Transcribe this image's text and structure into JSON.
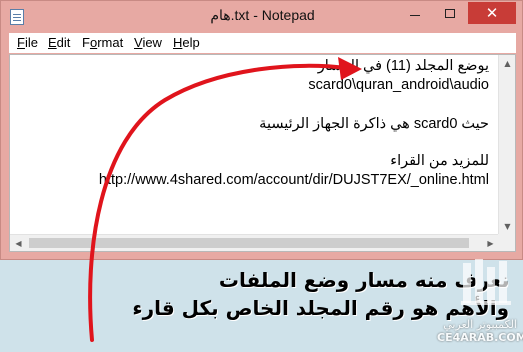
{
  "window": {
    "title": "هام.txt - Notepad",
    "controls": {
      "minimize": "",
      "maximize": "",
      "close": "✕"
    }
  },
  "menu": {
    "file": {
      "acc": "F",
      "rest": "ile"
    },
    "edit": {
      "acc": "E",
      "rest": "dit"
    },
    "format": {
      "acc": "o",
      "pre": "F",
      "rest": "rmat"
    },
    "view": {
      "acc": "V",
      "rest": "iew"
    },
    "help": {
      "acc": "H",
      "rest": "elp"
    }
  },
  "document": {
    "lines": [
      "يوضع المجلد (11) في المسار",
      "scard0\\quran_android\\audio",
      "حيث scard0 هي ذاكرة الجهاز الرئيسية",
      "للمزيد من القراء",
      "http://www.4shared.com/account/dir/DUJST7EX/_online.html"
    ]
  },
  "scrollbars": {
    "up": "▲",
    "down": "▼",
    "left": "◀",
    "right": "▶"
  },
  "caption": {
    "line1": "نعرف منه مسار وضع الملفات",
    "line2": "والأهم هو رقم المجلد الخاص بكل قارء"
  },
  "watermark": {
    "arabic": "الكمبيوتر العربي",
    "latin": "CE4ARAB.COM"
  },
  "colors": {
    "window_frame": "#e7a9a3",
    "close_button": "#c83c37",
    "arrow": "#e0141c",
    "background": "#cfe2ea"
  }
}
